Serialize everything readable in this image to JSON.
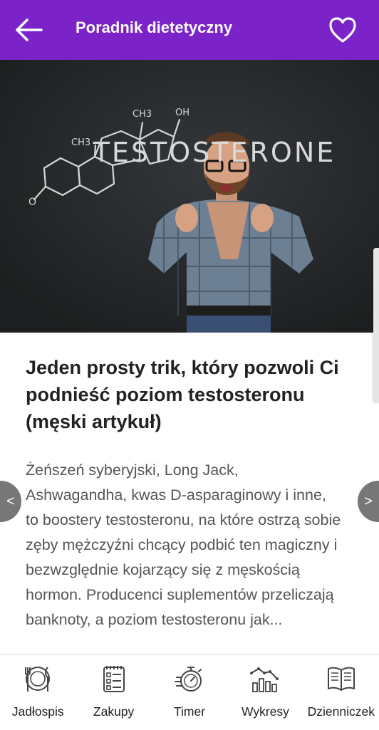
{
  "appbar": {
    "title": "Poradnik dietetyczny",
    "back_icon": "arrow-left-icon",
    "favorite_icon": "heart-outline-icon",
    "color": "#7b22c9"
  },
  "hero": {
    "chalk_word": "TESTOSTERONE",
    "formula_labels": [
      "CH3",
      "OH",
      "CH3",
      "O"
    ]
  },
  "article": {
    "title": "Jeden prosty trik, który pozwoli Ci podnieść poziom testosteronu (męski artykuł)",
    "body": "Żeńszeń syberyjski, Long Jack, Ashwagandha, kwas D-asparaginowy i inne, to boostery testosteronu, na które ostrzą sobie zęby mężczyźni chcący podbić ten magiczny i bezwzględnie kojarzący się z męskością hormon. Producenci suplementów przeliczają banknoty, a poziom testosteronu jak..."
  },
  "pager": {
    "prev": "<",
    "next": ">"
  },
  "bottom_nav": [
    {
      "label": "Jadłospis",
      "icon": "plate-cutlery-icon"
    },
    {
      "label": "Zakupy",
      "icon": "shopping-list-icon"
    },
    {
      "label": "Timer",
      "icon": "stopwatch-icon"
    },
    {
      "label": "Wykresy",
      "icon": "bar-chart-icon"
    },
    {
      "label": "Dzienniczek",
      "icon": "book-icon"
    }
  ]
}
